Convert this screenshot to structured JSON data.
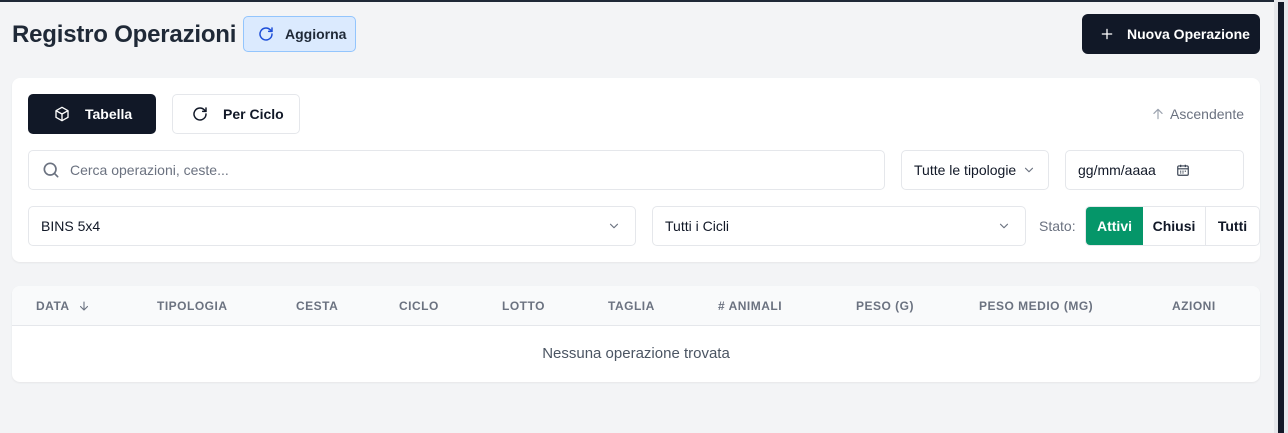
{
  "header": {
    "title": "Registro Operazioni",
    "refresh_label": "Aggiorna",
    "new_label": "Nuova Operazione"
  },
  "views": {
    "table_label": "Tabella",
    "cycle_label": "Per Ciclo"
  },
  "sort": {
    "label": "Ascendente"
  },
  "filters": {
    "search_placeholder": "Cerca operazioni, ceste...",
    "type_value": "Tutte le tipologie",
    "date_placeholder": "gg/mm/aaaa",
    "bins_value": "BINS 5x4",
    "cycles_value": "Tutti i Cicli",
    "stato_label": "Stato:",
    "stato_options": [
      "Attivi",
      "Chiusi",
      "Tutti"
    ],
    "stato_selected": "Attivi"
  },
  "table": {
    "columns": [
      "DATA",
      "TIPOLOGIA",
      "CESTA",
      "CICLO",
      "LOTTO",
      "TAGLIA",
      "# ANIMALI",
      "PESO (G)",
      "PESO MEDIO (MG)",
      "AZIONI"
    ],
    "sorted_column": "DATA",
    "empty_message": "Nessuna operazione trovata"
  },
  "colors": {
    "primary": "#111827",
    "success": "#059669",
    "refresh_bg": "#dbeafe"
  },
  "icons": [
    "refresh-icon",
    "plus-icon",
    "cube-icon",
    "arrow-up-icon",
    "search-icon",
    "chevron-down-icon",
    "calendar-icon",
    "arrow-down-icon"
  ]
}
